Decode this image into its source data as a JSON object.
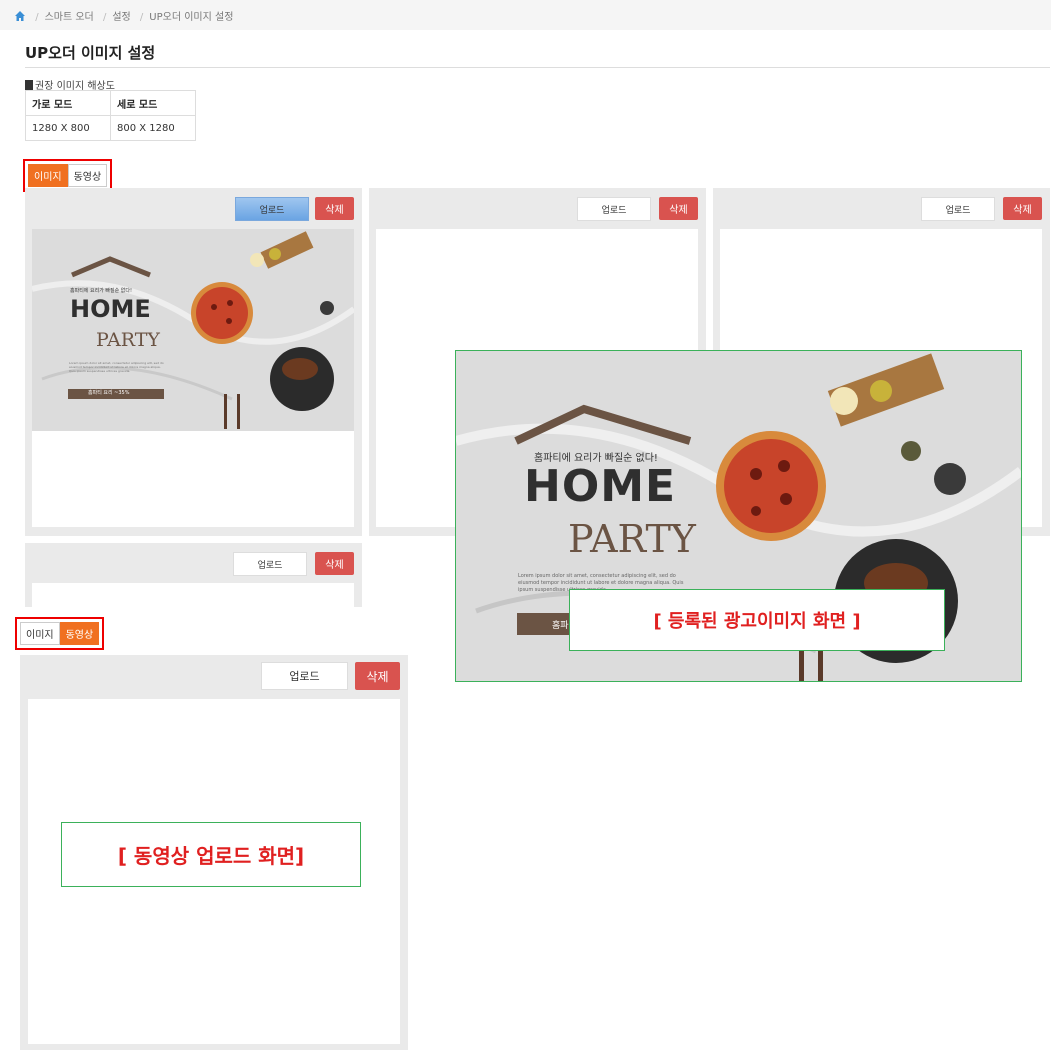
{
  "breadcrumb": {
    "items": [
      "스마트 오더",
      "설정",
      "UP오더 이미지 설정"
    ]
  },
  "page": {
    "title": "UP오더 이미지 설정"
  },
  "resolution": {
    "label": "권장 이미지 해상도",
    "headers": [
      "가로 모드",
      "세로 모드"
    ],
    "values": [
      "1280 X 800",
      "800 X 1280"
    ]
  },
  "tabs": {
    "image": "이미지",
    "video": "동영상"
  },
  "buttons": {
    "upload": "업로드",
    "delete": "삭제"
  },
  "ad": {
    "headline": "홈파티에 요리가 빠질순 없다!",
    "home": "HOME",
    "party": "PARTY",
    "sale": "홈파티 요리 ~35%",
    "lorem": "Lorem ipsum dolor sit amet, consectetur adipiscing elit, sed do eiusmod tempor incididunt ut labore et dolore magna aliqua. Quis ipsum suspendisse ultrices gravida."
  },
  "callouts": {
    "registered": "[ 등록된 광고이미지 화면 ]",
    "video_upload": "[ 동영상 업로드 화면]"
  },
  "colors": {
    "accent": "#f07020",
    "delete": "#d9534f",
    "highlight": "#e00000",
    "callout_border": "#3bb15a"
  }
}
